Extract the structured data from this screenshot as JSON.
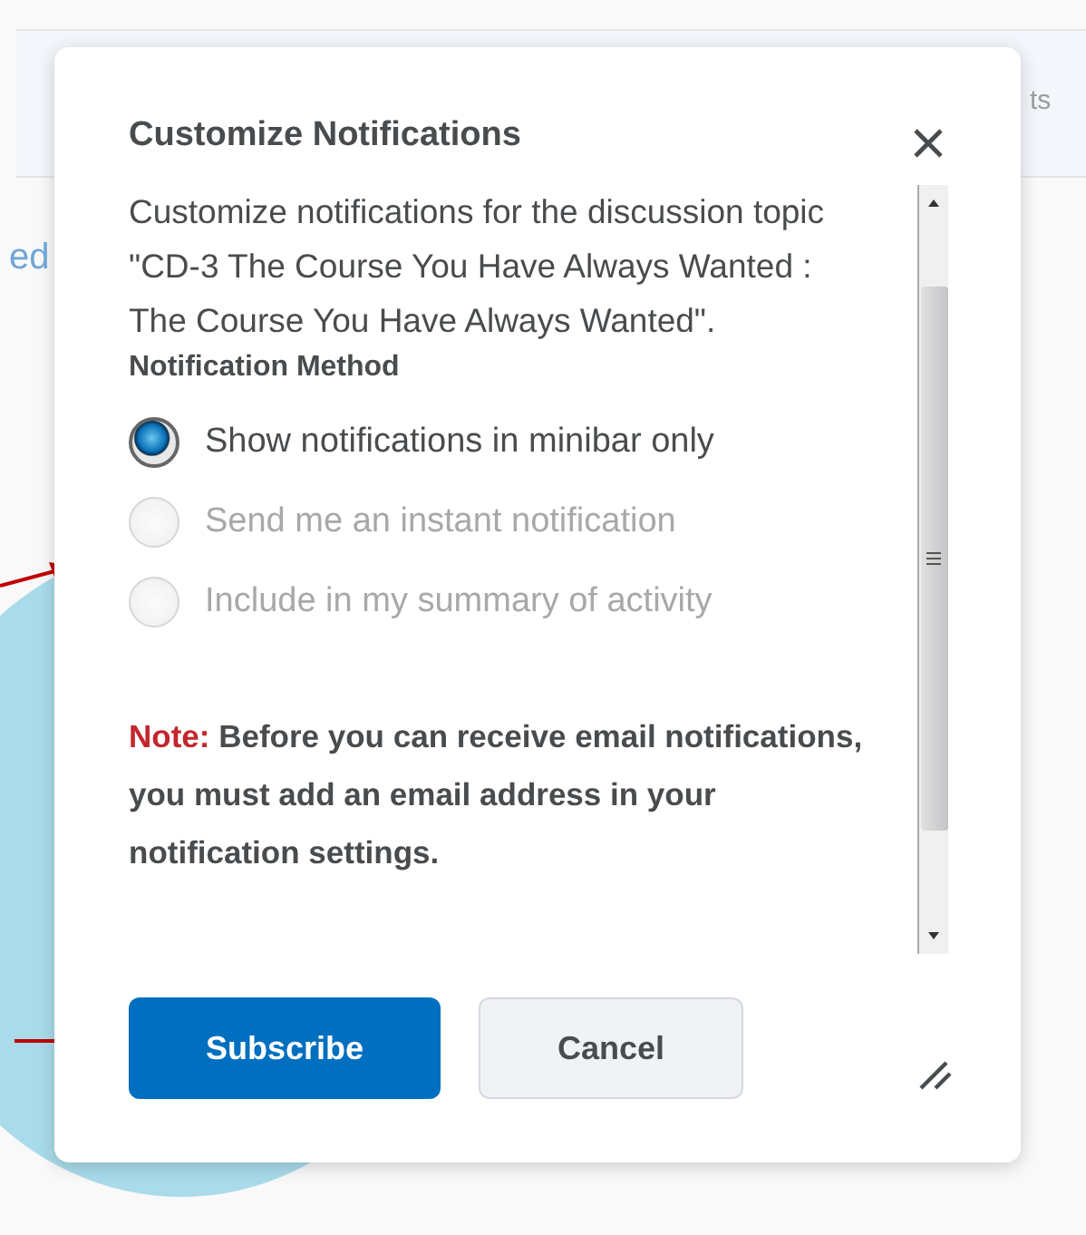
{
  "background": {
    "fragments": [
      {
        "text": "ed",
        "kind": "link"
      },
      {
        "text": "ts",
        "kind": "tab"
      }
    ]
  },
  "dialog": {
    "title": "Customize Notifications",
    "description": "Customize notifications for the discussion topic \"CD-3 The Course You Have Always Wanted : The Course You Have Always Wanted\".",
    "method_heading": "Notification Method",
    "options": [
      {
        "label": "Show notifications in minibar only",
        "selected": true,
        "disabled": false
      },
      {
        "label": "Send me an instant notification",
        "selected": false,
        "disabled": true
      },
      {
        "label": "Include in my summary of activity",
        "selected": false,
        "disabled": true
      }
    ],
    "note_label": "Note:",
    "note_text": "Before you can receive email notifications, you must add an email address in your notification settings.",
    "buttons": [
      {
        "label": "Subscribe",
        "kind": "primary"
      },
      {
        "label": "Cancel",
        "kind": "secondary"
      }
    ]
  }
}
